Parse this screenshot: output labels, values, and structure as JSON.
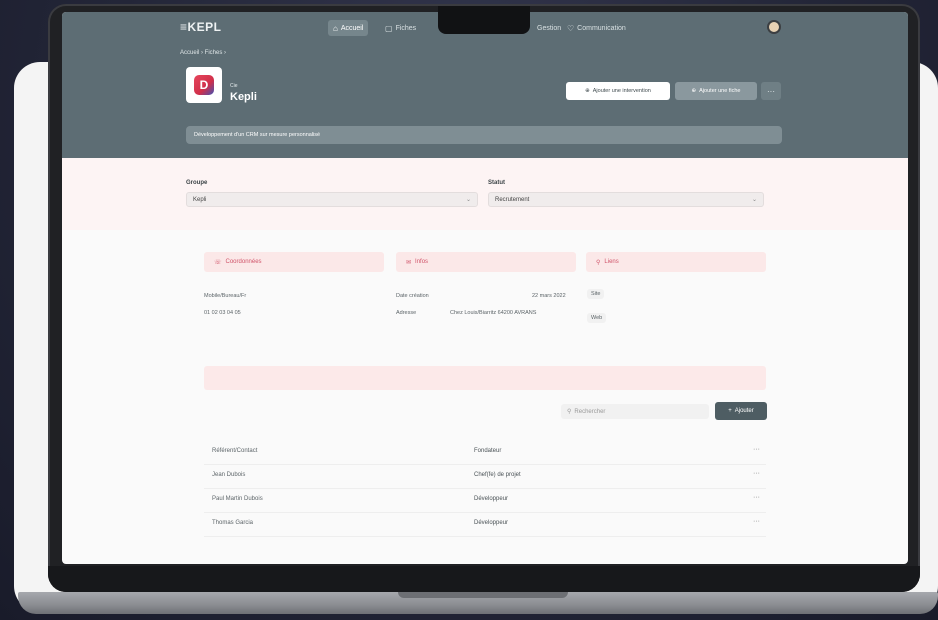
{
  "app": {
    "logo": "≡KEPL",
    "nav": [
      {
        "icon": "home-icon",
        "glyph": "⌂",
        "label": "Accueil",
        "active": true
      },
      {
        "icon": "folder-icon",
        "glyph": "▢",
        "label": "Fiches",
        "active": false
      },
      {
        "icon": "grid-icon",
        "glyph": "",
        "label": "Gestion",
        "active": false
      },
      {
        "icon": "heart-icon",
        "glyph": "♡",
        "label": "Communication",
        "active": false
      }
    ]
  },
  "header": {
    "breadcrumb": "Accueil  ›  Fiches  ›",
    "brand_sub": "Cie",
    "brand_name": "Kepli",
    "brand_mark": "D",
    "btn_outline": "Ajouter une intervention",
    "btn_solid": "Ajouter une fiche",
    "btn_more": "···",
    "info": "Développement d'un CRM sur mesure personnalisé"
  },
  "fields": {
    "group_label": "Groupe",
    "group_value": "Kepli",
    "status_label": "Statut",
    "status_value": "Recrutement",
    "chevron": "⌄"
  },
  "contacts": {
    "phone": {
      "label": "Coordonnées",
      "glyph": "☏",
      "lines": [
        "Mobile/Bureau/Fr",
        "01 02 03 04 05"
      ]
    },
    "address": {
      "label": "Infos",
      "glyph": "✉",
      "line1_k": "Date création",
      "line1_v": "22 mars 2022",
      "line2_k": "Adresse",
      "line2_v": "Chez Louis/Biarritz 64200 AVRANS"
    },
    "tags": {
      "label": "Liens",
      "glyph": "⚲",
      "items": [
        "Site",
        "Web"
      ]
    }
  },
  "list": {
    "search_placeholder": "Rechercher",
    "add_label": "Ajouter",
    "rows": [
      {
        "name": "Référent/Contact",
        "role": "Fondateur",
        "more": "···"
      },
      {
        "name": "Jean Dubois",
        "role": "Chef(fe) de projet",
        "more": "···"
      },
      {
        "name": "Paul Martin Dubois",
        "role": "Développeur",
        "more": "···"
      },
      {
        "name": "Thomas Garcia",
        "role": "Développeur",
        "more": "···"
      }
    ]
  },
  "colors": {
    "header_bg": "#5d6d74",
    "accent": "#d0546a",
    "button_dark": "#4e5d63"
  }
}
